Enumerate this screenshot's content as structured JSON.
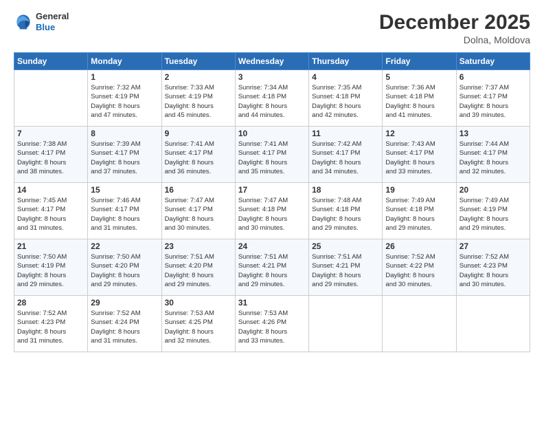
{
  "header": {
    "logo": {
      "general": "General",
      "blue": "Blue"
    },
    "title": "December 2025",
    "location": "Dolna, Moldova"
  },
  "weekdays": [
    "Sunday",
    "Monday",
    "Tuesday",
    "Wednesday",
    "Thursday",
    "Friday",
    "Saturday"
  ],
  "weeks": [
    [
      {
        "day": "",
        "info": ""
      },
      {
        "day": "1",
        "info": "Sunrise: 7:32 AM\nSunset: 4:19 PM\nDaylight: 8 hours\nand 47 minutes."
      },
      {
        "day": "2",
        "info": "Sunrise: 7:33 AM\nSunset: 4:19 PM\nDaylight: 8 hours\nand 45 minutes."
      },
      {
        "day": "3",
        "info": "Sunrise: 7:34 AM\nSunset: 4:18 PM\nDaylight: 8 hours\nand 44 minutes."
      },
      {
        "day": "4",
        "info": "Sunrise: 7:35 AM\nSunset: 4:18 PM\nDaylight: 8 hours\nand 42 minutes."
      },
      {
        "day": "5",
        "info": "Sunrise: 7:36 AM\nSunset: 4:18 PM\nDaylight: 8 hours\nand 41 minutes."
      },
      {
        "day": "6",
        "info": "Sunrise: 7:37 AM\nSunset: 4:17 PM\nDaylight: 8 hours\nand 39 minutes."
      }
    ],
    [
      {
        "day": "7",
        "info": "Sunrise: 7:38 AM\nSunset: 4:17 PM\nDaylight: 8 hours\nand 38 minutes."
      },
      {
        "day": "8",
        "info": "Sunrise: 7:39 AM\nSunset: 4:17 PM\nDaylight: 8 hours\nand 37 minutes."
      },
      {
        "day": "9",
        "info": "Sunrise: 7:41 AM\nSunset: 4:17 PM\nDaylight: 8 hours\nand 36 minutes."
      },
      {
        "day": "10",
        "info": "Sunrise: 7:41 AM\nSunset: 4:17 PM\nDaylight: 8 hours\nand 35 minutes."
      },
      {
        "day": "11",
        "info": "Sunrise: 7:42 AM\nSunset: 4:17 PM\nDaylight: 8 hours\nand 34 minutes."
      },
      {
        "day": "12",
        "info": "Sunrise: 7:43 AM\nSunset: 4:17 PM\nDaylight: 8 hours\nand 33 minutes."
      },
      {
        "day": "13",
        "info": "Sunrise: 7:44 AM\nSunset: 4:17 PM\nDaylight: 8 hours\nand 32 minutes."
      }
    ],
    [
      {
        "day": "14",
        "info": "Sunrise: 7:45 AM\nSunset: 4:17 PM\nDaylight: 8 hours\nand 31 minutes."
      },
      {
        "day": "15",
        "info": "Sunrise: 7:46 AM\nSunset: 4:17 PM\nDaylight: 8 hours\nand 31 minutes."
      },
      {
        "day": "16",
        "info": "Sunrise: 7:47 AM\nSunset: 4:17 PM\nDaylight: 8 hours\nand 30 minutes."
      },
      {
        "day": "17",
        "info": "Sunrise: 7:47 AM\nSunset: 4:18 PM\nDaylight: 8 hours\nand 30 minutes."
      },
      {
        "day": "18",
        "info": "Sunrise: 7:48 AM\nSunset: 4:18 PM\nDaylight: 8 hours\nand 29 minutes."
      },
      {
        "day": "19",
        "info": "Sunrise: 7:49 AM\nSunset: 4:18 PM\nDaylight: 8 hours\nand 29 minutes."
      },
      {
        "day": "20",
        "info": "Sunrise: 7:49 AM\nSunset: 4:19 PM\nDaylight: 8 hours\nand 29 minutes."
      }
    ],
    [
      {
        "day": "21",
        "info": "Sunrise: 7:50 AM\nSunset: 4:19 PM\nDaylight: 8 hours\nand 29 minutes."
      },
      {
        "day": "22",
        "info": "Sunrise: 7:50 AM\nSunset: 4:20 PM\nDaylight: 8 hours\nand 29 minutes."
      },
      {
        "day": "23",
        "info": "Sunrise: 7:51 AM\nSunset: 4:20 PM\nDaylight: 8 hours\nand 29 minutes."
      },
      {
        "day": "24",
        "info": "Sunrise: 7:51 AM\nSunset: 4:21 PM\nDaylight: 8 hours\nand 29 minutes."
      },
      {
        "day": "25",
        "info": "Sunrise: 7:51 AM\nSunset: 4:21 PM\nDaylight: 8 hours\nand 29 minutes."
      },
      {
        "day": "26",
        "info": "Sunrise: 7:52 AM\nSunset: 4:22 PM\nDaylight: 8 hours\nand 30 minutes."
      },
      {
        "day": "27",
        "info": "Sunrise: 7:52 AM\nSunset: 4:23 PM\nDaylight: 8 hours\nand 30 minutes."
      }
    ],
    [
      {
        "day": "28",
        "info": "Sunrise: 7:52 AM\nSunset: 4:23 PM\nDaylight: 8 hours\nand 31 minutes."
      },
      {
        "day": "29",
        "info": "Sunrise: 7:52 AM\nSunset: 4:24 PM\nDaylight: 8 hours\nand 31 minutes."
      },
      {
        "day": "30",
        "info": "Sunrise: 7:53 AM\nSunset: 4:25 PM\nDaylight: 8 hours\nand 32 minutes."
      },
      {
        "day": "31",
        "info": "Sunrise: 7:53 AM\nSunset: 4:26 PM\nDaylight: 8 hours\nand 33 minutes."
      },
      {
        "day": "",
        "info": ""
      },
      {
        "day": "",
        "info": ""
      },
      {
        "day": "",
        "info": ""
      }
    ]
  ]
}
